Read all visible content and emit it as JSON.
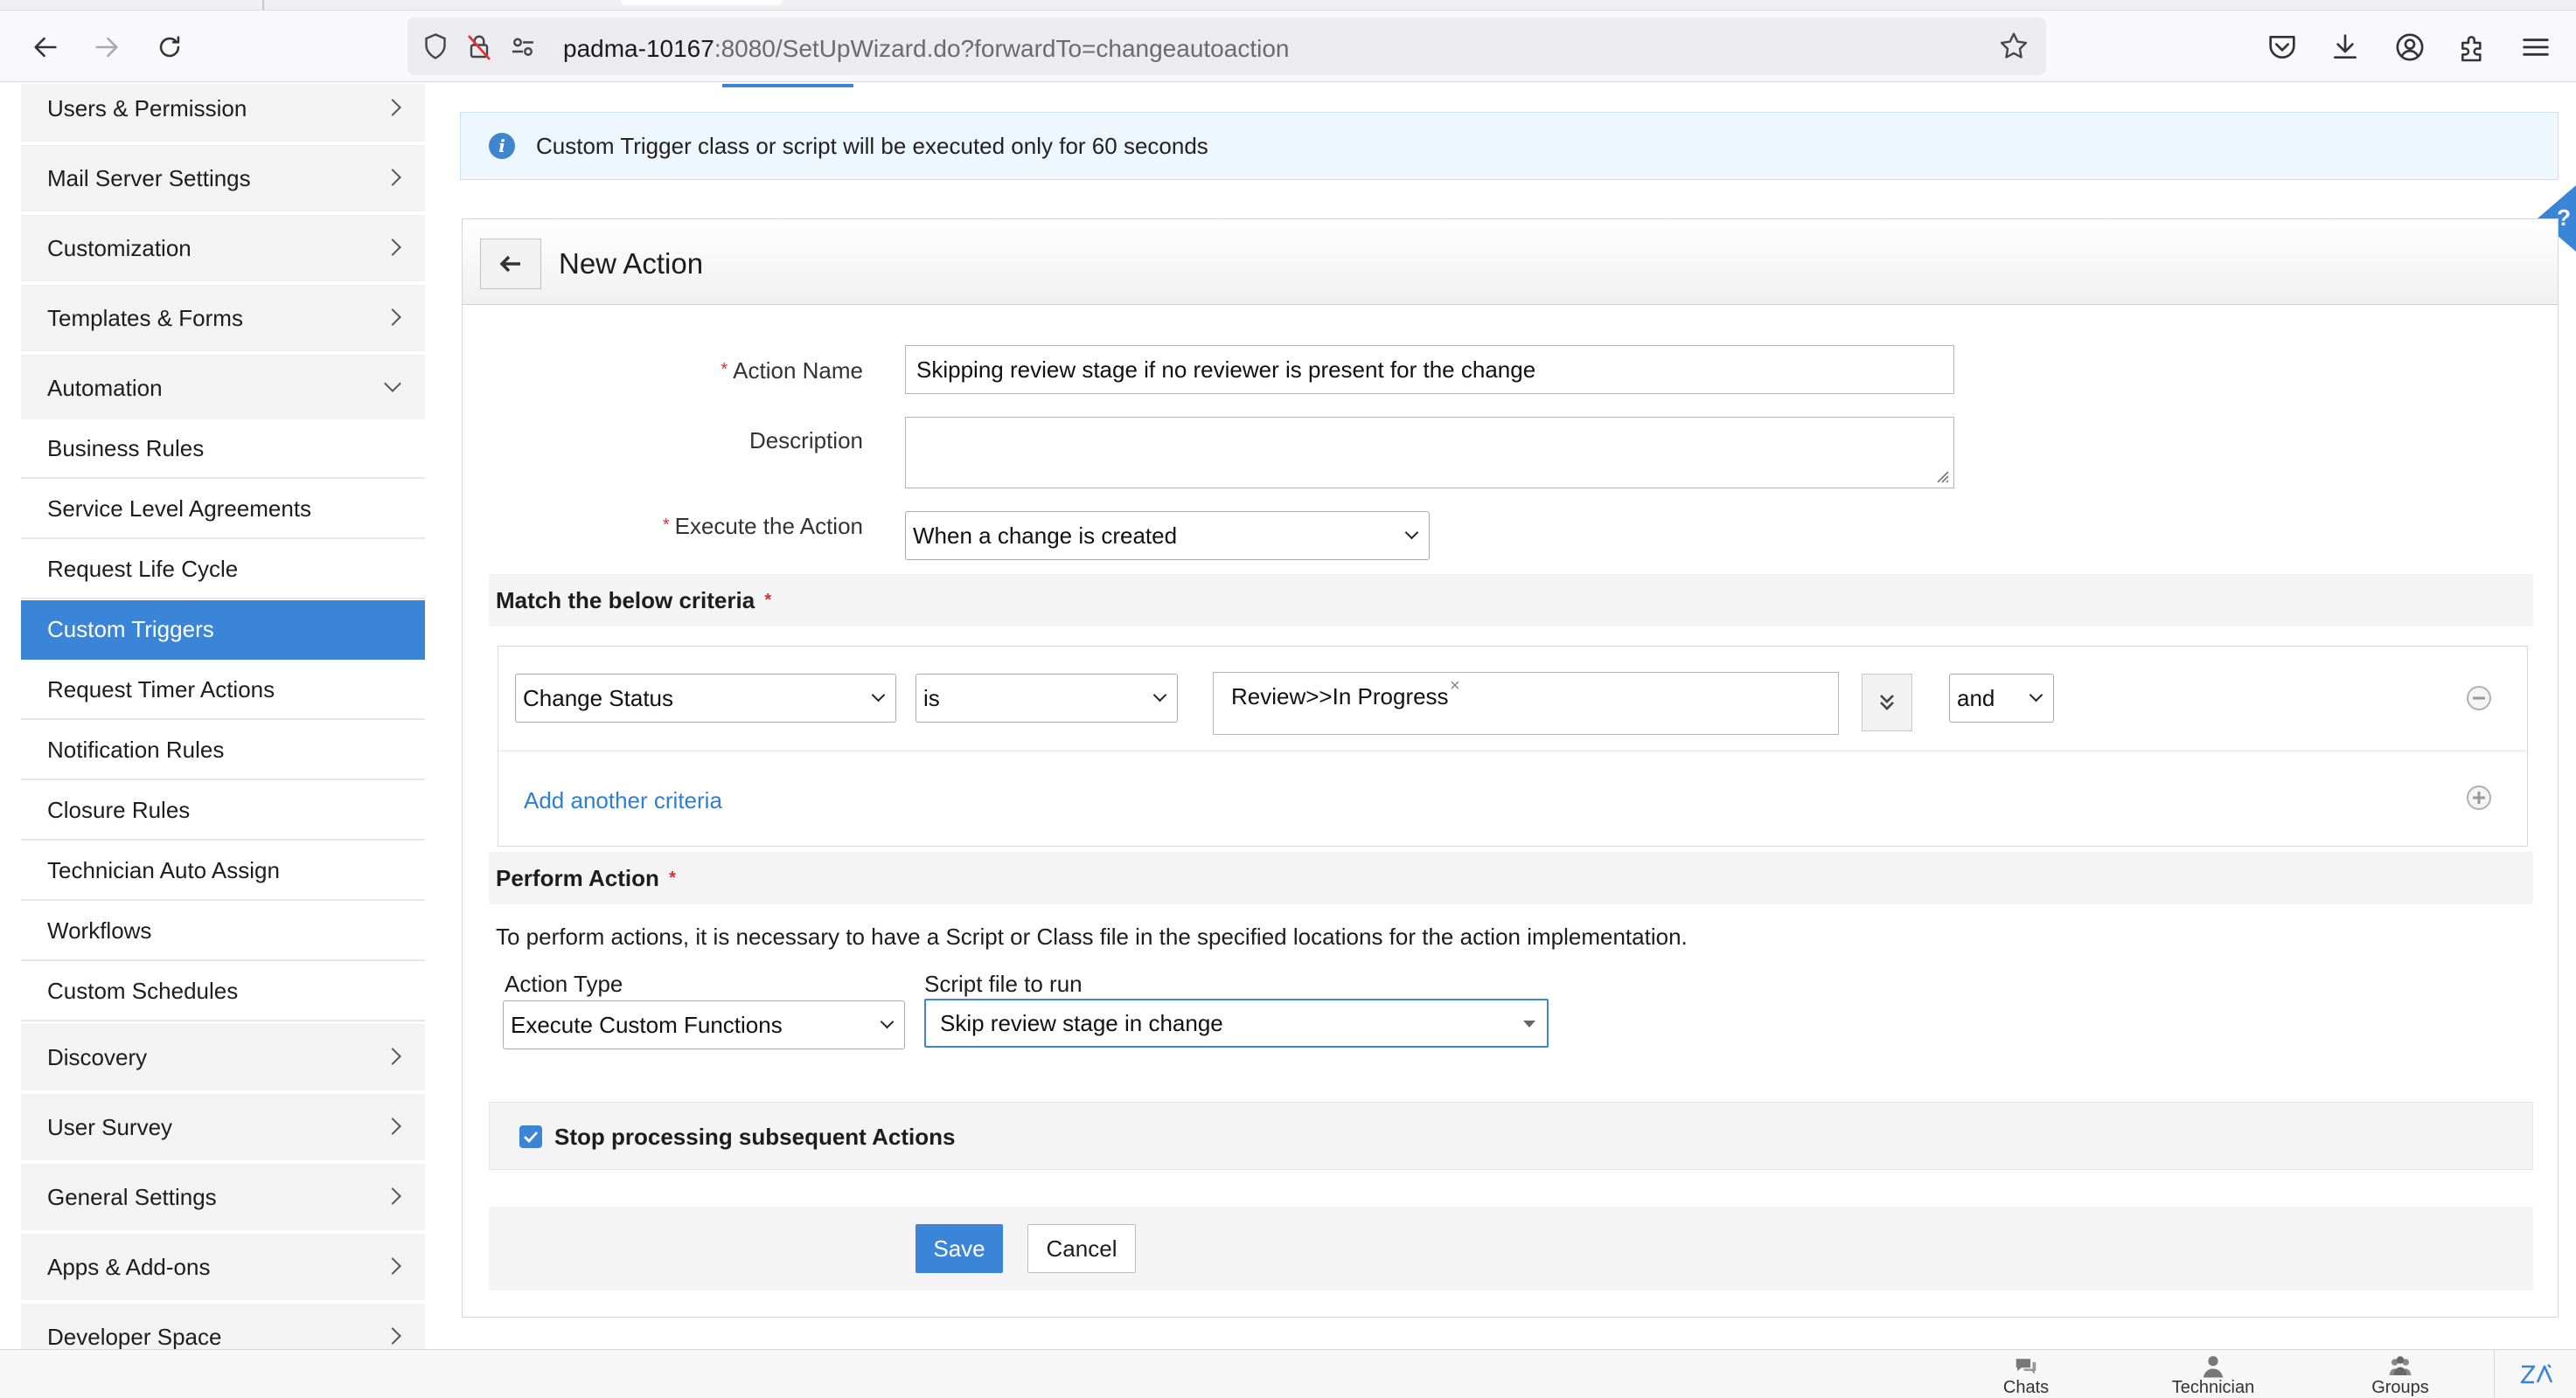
{
  "browser": {
    "url_host": "padma-10167",
    "url_rest": ":8080/SetUpWizard.do?forwardTo=changeautoaction"
  },
  "sidebar": {
    "items": [
      {
        "label": "Users & Permission"
      },
      {
        "label": "Mail Server Settings"
      },
      {
        "label": "Customization"
      },
      {
        "label": "Templates & Forms"
      },
      {
        "label": "Automation",
        "expanded": true
      }
    ],
    "automation_children": [
      {
        "label": "Business Rules"
      },
      {
        "label": "Service Level Agreements"
      },
      {
        "label": "Request Life Cycle"
      },
      {
        "label": "Custom Triggers",
        "active": true
      },
      {
        "label": "Request Timer Actions"
      },
      {
        "label": "Notification Rules"
      },
      {
        "label": "Closure Rules"
      },
      {
        "label": "Technician Auto Assign"
      },
      {
        "label": "Workflows"
      },
      {
        "label": "Custom Schedules"
      }
    ],
    "items_after": [
      {
        "label": "Discovery"
      },
      {
        "label": "User Survey"
      },
      {
        "label": "General Settings"
      },
      {
        "label": "Apps & Add-ons"
      },
      {
        "label": "Developer Space"
      }
    ]
  },
  "info": {
    "text": "Custom Trigger class or script will be executed only for 60 seconds"
  },
  "help": {
    "label": "?"
  },
  "form": {
    "title": "New Action",
    "required_mark": "*",
    "action_name_label": "Action Name",
    "action_name_value": "Skipping review stage if no reviewer is present for the change",
    "description_label": "Description",
    "description_value": "",
    "execute_label": "Execute the Action",
    "execute_value": "When a change is created",
    "criteria_heading": "Match the below criteria",
    "criteria": {
      "field": "Change Status",
      "operator": "is",
      "value_chip": "Review>>In Progress",
      "chip_remove": "×",
      "conjunction": "and"
    },
    "add_criteria_label": "Add another criteria",
    "perform_heading": "Perform Action",
    "perform_note": "To perform actions, it is necessary to have a Script or Class file in the specified locations for the action implementation.",
    "action_type_label": "Action Type",
    "action_type_value": "Execute Custom Functions",
    "script_label": "Script file to run",
    "script_value": "Skip review stage in change",
    "stop_label": "Stop processing subsequent Actions",
    "stop_checked": true,
    "save_label": "Save",
    "cancel_label": "Cancel"
  },
  "bottom_bar": {
    "chats": "Chats",
    "technician": "Technician",
    "groups": "Groups"
  },
  "colors": {
    "accent": "#3a85d8",
    "required": "#d9302e",
    "link": "#2f7fd1"
  }
}
